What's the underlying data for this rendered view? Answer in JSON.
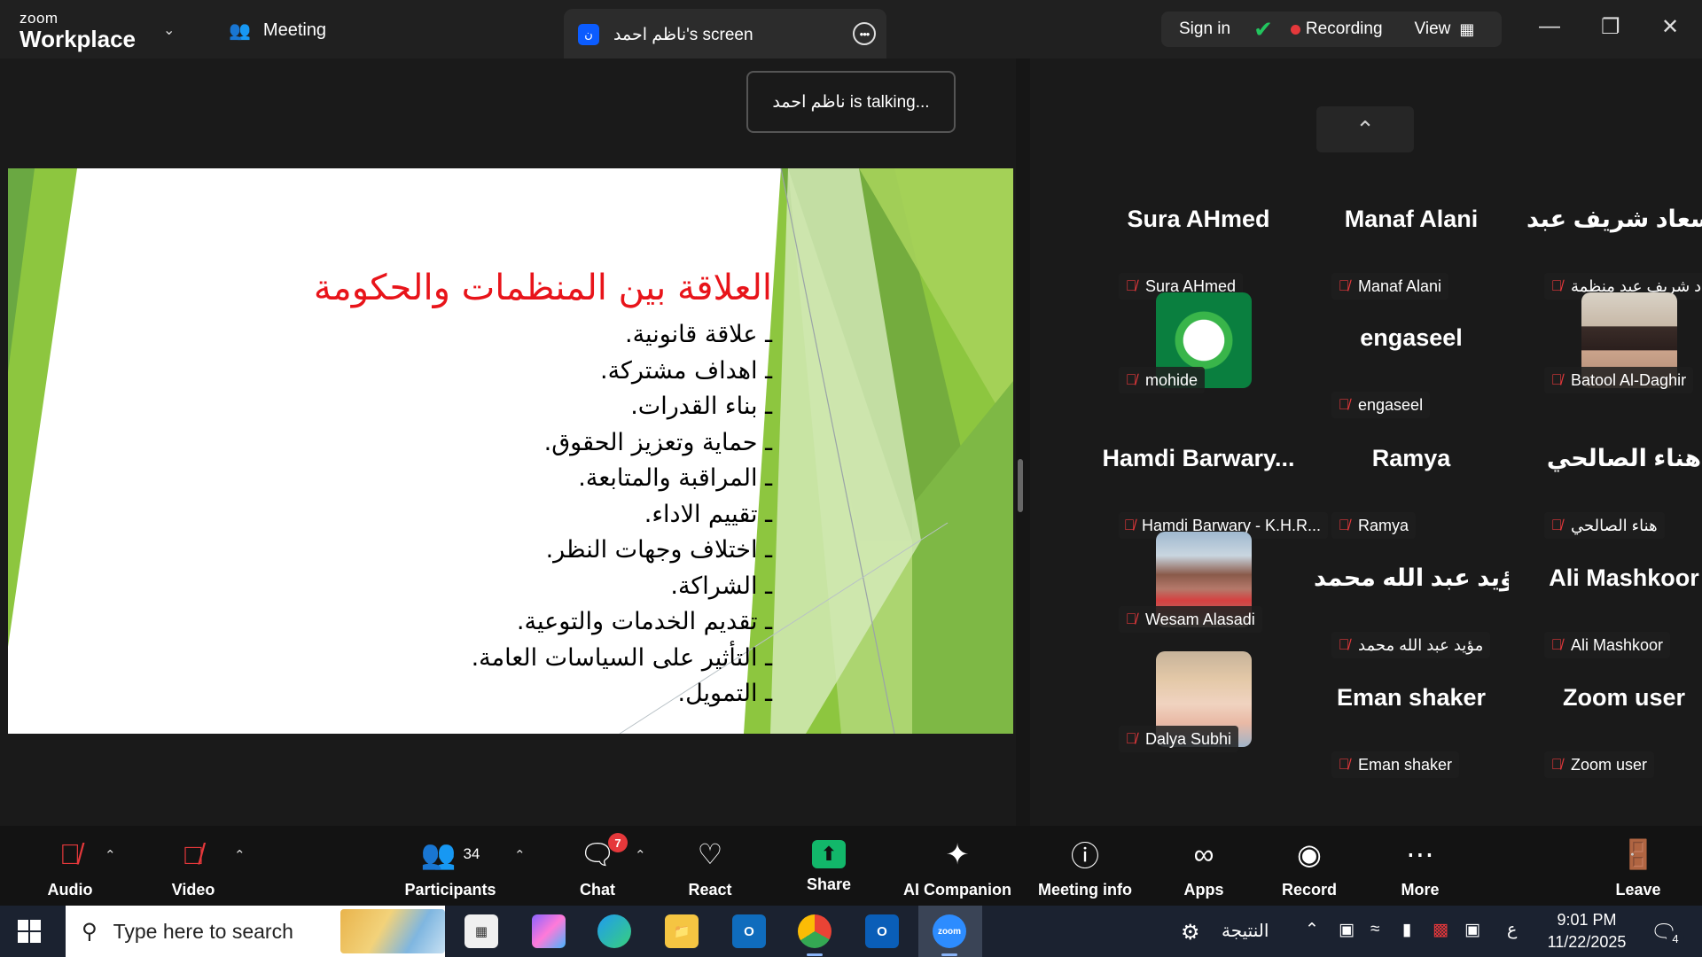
{
  "titlebar": {
    "brand_small": "zoom",
    "brand_main": "Workplace",
    "meeting_tab": "Meeting",
    "screen_tab_avatar": "ن",
    "screen_tab_title": "ناظم احمد's screen",
    "sign_in": "Sign in",
    "recording": "Recording",
    "view": "View"
  },
  "talking_toast": "ناظم احمد is talking...",
  "slide": {
    "title": "العلاقة بين المنظمات والحكومة",
    "bullets": [
      "علاقة قانونية.",
      "اهداف مشتركة.",
      "بناء القدرات.",
      "حماية وتعزيز الحقوق.",
      "المراقبة والمتابعة.",
      "تقييم الاداء.",
      "اختلاف وجهات النظر.",
      "الشراكة.",
      "تقديم الخدمات والتوعية.",
      "التأثير على السياسات العامة.",
      "التمويل."
    ]
  },
  "participants": [
    {
      "display": "Sura AHmed",
      "label": "Sura AHmed"
    },
    {
      "display": "Manaf Alani",
      "label": "Manaf Alani"
    },
    {
      "display": "سعاد شريف عبد...",
      "label": "سعاد شريف عبد منظمة..."
    },
    {
      "display": "",
      "label": "mohide"
    },
    {
      "display": "engaseel",
      "label": "engaseel"
    },
    {
      "display": "",
      "label": "Batool Al-Daghir"
    },
    {
      "display": "Hamdi  Barwary...",
      "label": "Hamdi Barwary - K.H.R..."
    },
    {
      "display": "Ramya",
      "label": "Ramya"
    },
    {
      "display": "هناء الصالحي",
      "label": "هناء الصالحي"
    },
    {
      "display": "",
      "label": "Wesam Alasadi"
    },
    {
      "display": "مؤيد عبد الله محمد",
      "label": "مؤيد عبد الله محمد"
    },
    {
      "display": "Ali Mashkoor",
      "label": "Ali Mashkoor"
    },
    {
      "display": "",
      "label": "Dalya Subhi"
    },
    {
      "display": "Eman shaker",
      "label": "Eman shaker"
    },
    {
      "display": "Zoom user",
      "label": "Zoom user"
    }
  ],
  "toolbar": {
    "audio": "Audio",
    "video": "Video",
    "participants": "Participants",
    "participants_count": "34",
    "chat": "Chat",
    "chat_badge": "7",
    "react": "React",
    "share": "Share",
    "ai_companion": "AI Companion",
    "meeting_info": "Meeting info",
    "apps": "Apps",
    "record": "Record",
    "more": "More",
    "leave": "Leave"
  },
  "taskbar": {
    "search_placeholder": "Type here to search",
    "result_text": "النتيجة",
    "lang": "ع",
    "time": "9:01 PM",
    "date": "11/22/2025",
    "notif_count": "4",
    "zoom_icon_text": "zoom"
  },
  "colors": {
    "accent_blue": "#0b5cff",
    "record_red": "#e5383b",
    "shield_green": "#22c55e",
    "share_green": "#12b76a",
    "slide_title_red": "#e8141a"
  }
}
